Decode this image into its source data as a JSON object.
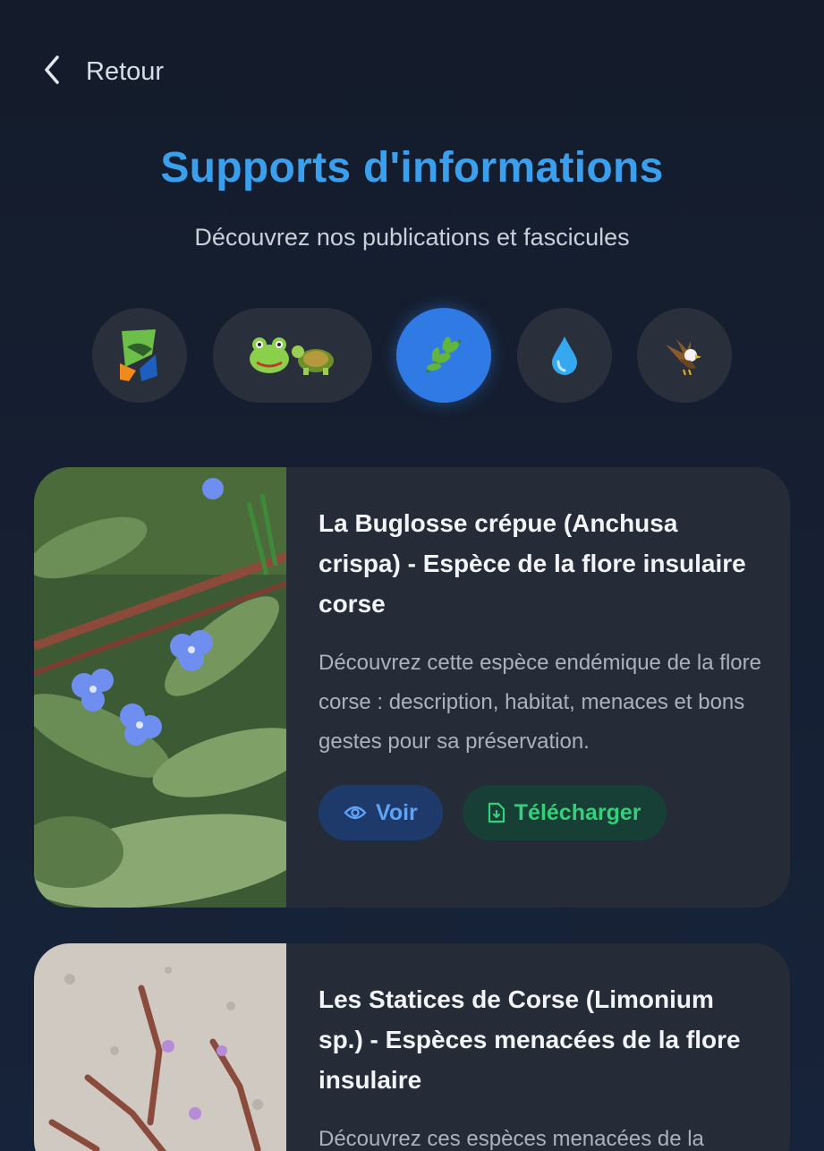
{
  "header": {
    "back_label": "Retour",
    "title": "Supports d'informations",
    "subtitle": "Découvrez nos publications et fascicules"
  },
  "filters": [
    {
      "icon": "conservatory-logo-icon",
      "active": false
    },
    {
      "icon": "frog-turtle-icon",
      "active": false
    },
    {
      "icon": "leaf-icon",
      "active": true
    },
    {
      "icon": "water-drop-icon",
      "active": false
    },
    {
      "icon": "eagle-icon",
      "active": false
    }
  ],
  "colors": {
    "accent": "#3aa0ee",
    "active_chip": "#2f7ae5",
    "view_button": "#5ea2f5",
    "download_button": "#34d07a"
  },
  "cards": [
    {
      "title": "La Buglosse crépue (Anchusa crispa) - Espèce de la flore insulaire corse",
      "description": "Découvrez cette espèce endémique de la flore corse : description, habitat, menaces et bons gestes pour sa préservation.",
      "view_label": "Voir",
      "download_label": "Télécharger"
    },
    {
      "title": "Les Statices de Corse (Limonium sp.) - Espèces menacées de la flore insulaire",
      "description": "Découvrez ces espèces menacées de la"
    }
  ]
}
